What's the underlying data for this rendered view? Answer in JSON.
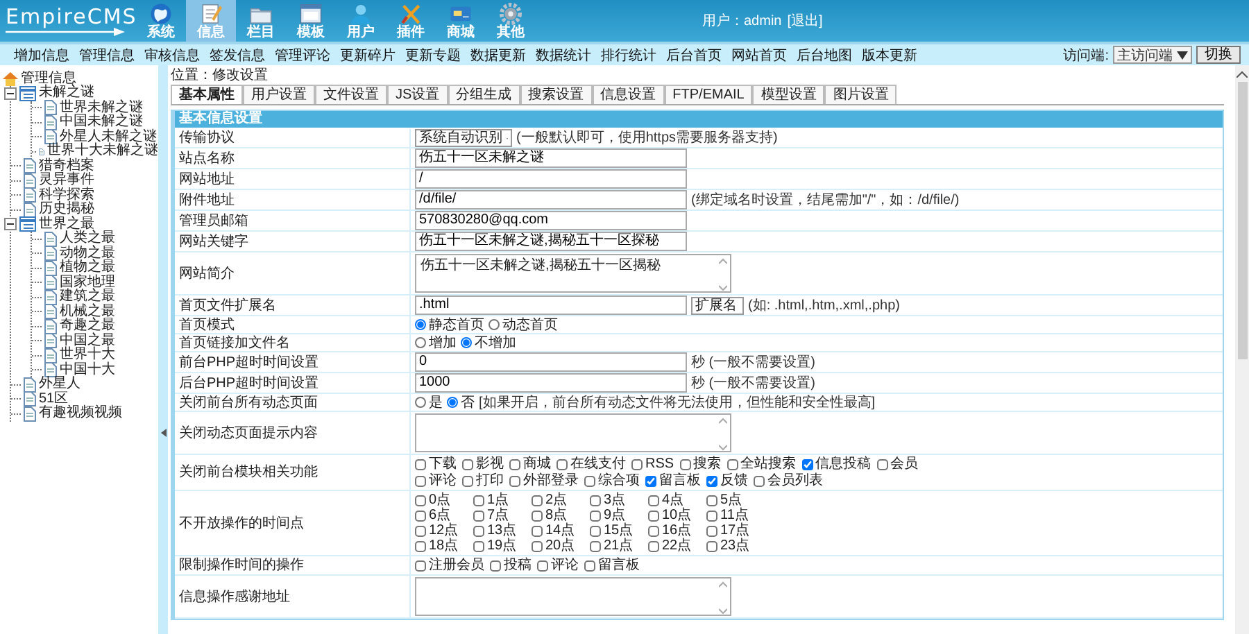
{
  "logo": "EmpireCMS",
  "nav": [
    {
      "label": "系统",
      "selected": false
    },
    {
      "label": "信息",
      "selected": true
    },
    {
      "label": "栏目",
      "selected": false
    },
    {
      "label": "模板",
      "selected": false
    },
    {
      "label": "用户",
      "selected": false
    },
    {
      "label": "插件",
      "selected": false
    },
    {
      "label": "商城",
      "selected": false
    },
    {
      "label": "其他",
      "selected": false
    }
  ],
  "user": {
    "text": "用户：admin",
    "logout": "[退出]"
  },
  "menu": [
    "增加信息",
    "管理信息",
    "审核信息",
    "签发信息",
    "管理评论",
    "更新碎片",
    "更新专题",
    "数据更新",
    "数据统计",
    "排行统计",
    "后台首页",
    "网站首页",
    "后台地图",
    "版本更新"
  ],
  "terminal": {
    "label": "访问端:",
    "value": "主访问端",
    "button": "切换"
  },
  "tree": {
    "label": "管理信息",
    "children": [
      {
        "label": "未解之谜",
        "expanded": true,
        "children": [
          {
            "label": "世界未解之谜"
          },
          {
            "label": "中国未解之谜"
          },
          {
            "label": "外星人未解之谜"
          },
          {
            "label": "世界十大未解之谜"
          }
        ]
      },
      {
        "label": "猎奇档案"
      },
      {
        "label": "灵异事件"
      },
      {
        "label": "科学探索"
      },
      {
        "label": "历史揭秘"
      },
      {
        "label": "世界之最",
        "expanded": true,
        "children": [
          {
            "label": "人类之最"
          },
          {
            "label": "动物之最"
          },
          {
            "label": "植物之最"
          },
          {
            "label": "国家地理"
          },
          {
            "label": "建筑之最"
          },
          {
            "label": "机械之最"
          },
          {
            "label": "奇趣之最"
          },
          {
            "label": "中国之最"
          },
          {
            "label": "世界十大"
          },
          {
            "label": "中国十大"
          }
        ]
      },
      {
        "label": "外星人"
      },
      {
        "label": "51区"
      },
      {
        "label": "有趣视频视频"
      }
    ]
  },
  "location": "位置：修改设置",
  "tabs": [
    {
      "label": "基本属性",
      "selected": true
    },
    {
      "label": "用户设置",
      "selected": false
    },
    {
      "label": "文件设置",
      "selected": false
    },
    {
      "label": "JS设置",
      "selected": false
    },
    {
      "label": "分组生成",
      "selected": false
    },
    {
      "label": "搜索设置",
      "selected": false
    },
    {
      "label": "信息设置",
      "selected": false
    },
    {
      "label": "FTP/EMAIL",
      "selected": false
    },
    {
      "label": "模型设置",
      "selected": false
    },
    {
      "label": "图片设置",
      "selected": false
    }
  ],
  "form": {
    "title": "基本信息设置",
    "rows": [
      {
        "label": "传输协议",
        "kind": "select",
        "value": "系统自动识别",
        "note": "(一般默认即可，使用https需要服务器支持)"
      },
      {
        "label": "站点名称",
        "kind": "text",
        "value": "伤五十一区未解之谜"
      },
      {
        "label": "网站地址",
        "kind": "text",
        "value": "/"
      },
      {
        "label": "附件地址",
        "kind": "text",
        "value": "/d/file/",
        "note": "(绑定域名时设置，结尾需加\"/\"，如：/d/file/)"
      },
      {
        "label": "管理员邮箱",
        "kind": "text",
        "value": "570830280@qq.com"
      },
      {
        "label": "网站关键字",
        "kind": "text",
        "value": "伤五十一区未解之谜,揭秘五十一区探秘"
      },
      {
        "label": "网站简介",
        "kind": "textarea",
        "value": "伤五十一区未解之谜,揭秘五十一区揭秘"
      },
      {
        "label": "首页文件扩展名",
        "kind": "text_select",
        "value": ".html",
        "select": "扩展名",
        "note": "(如: .html,.htm,.xml,.php)"
      },
      {
        "label": "首页模式",
        "kind": "radio",
        "options": [
          {
            "label": "静态首页",
            "selected": true
          },
          {
            "label": "动态首页",
            "selected": false
          }
        ]
      },
      {
        "label": "首页链接加文件名",
        "kind": "radio",
        "options": [
          {
            "label": "增加",
            "selected": false
          },
          {
            "label": "不增加",
            "selected": true
          }
        ]
      },
      {
        "label": "前台PHP超时时间设置",
        "kind": "text",
        "value": "0",
        "note": "秒 (一般不需要设置)"
      },
      {
        "label": "后台PHP超时时间设置",
        "kind": "text",
        "value": "1000",
        "note": "秒 (一般不需要设置)"
      },
      {
        "label": "关闭前台所有动态页面",
        "kind": "radio",
        "options": [
          {
            "label": "是",
            "selected": false
          },
          {
            "label": "否",
            "selected": true
          }
        ],
        "note": "[如果开启，前台所有动态文件将无法使用，但性能和安全性最高]"
      },
      {
        "label": "关闭动态页面提示内容",
        "kind": "textarea"
      },
      {
        "label": "关闭前台模块相关功能",
        "kind": "checks",
        "options": [
          {
            "label": "下载",
            "checked": false
          },
          {
            "label": "影视",
            "checked": false
          },
          {
            "label": "商城",
            "checked": false
          },
          {
            "label": "在线支付",
            "checked": false
          },
          {
            "label": "RSS",
            "checked": false
          },
          {
            "label": "搜索",
            "checked": false
          },
          {
            "label": "全站搜索",
            "checked": false
          },
          {
            "label": "信息投稿",
            "checked": true
          },
          {
            "label": "会员",
            "checked": false
          },
          {
            "label": "评论",
            "checked": false
          },
          {
            "label": "打印",
            "checked": false
          },
          {
            "label": "外部登录",
            "checked": false
          },
          {
            "label": "综合项",
            "checked": false
          },
          {
            "label": "留言板",
            "checked": true
          },
          {
            "label": "反馈",
            "checked": true
          },
          {
            "label": "会员列表",
            "checked": false
          }
        ]
      },
      {
        "label": "不开放操作的时间点",
        "kind": "hours",
        "options": [
          {
            "label": "0点",
            "checked": false
          },
          {
            "label": "1点",
            "checked": false
          },
          {
            "label": "2点",
            "checked": false
          },
          {
            "label": "3点",
            "checked": false
          },
          {
            "label": "4点",
            "checked": false
          },
          {
            "label": "5点",
            "checked": false
          },
          {
            "label": "6点",
            "checked": false
          },
          {
            "label": "7点",
            "checked": false
          },
          {
            "label": "8点",
            "checked": false
          },
          {
            "label": "9点",
            "checked": false
          },
          {
            "label": "10点",
            "checked": false
          },
          {
            "label": "11点",
            "checked": false
          },
          {
            "label": "12点",
            "checked": false
          },
          {
            "label": "13点",
            "checked": false
          },
          {
            "label": "14点",
            "checked": false
          },
          {
            "label": "15点",
            "checked": false
          },
          {
            "label": "16点",
            "checked": false
          },
          {
            "label": "17点",
            "checked": false
          },
          {
            "label": "18点",
            "checked": false
          },
          {
            "label": "19点",
            "checked": false
          },
          {
            "label": "20点",
            "checked": false
          },
          {
            "label": "21点",
            "checked": false
          },
          {
            "label": "22点",
            "checked": false
          },
          {
            "label": "23点",
            "checked": false
          }
        ]
      },
      {
        "label": "限制操作时间的操作",
        "kind": "checks",
        "options": [
          {
            "label": "注册会员",
            "checked": false
          },
          {
            "label": "投稿",
            "checked": false
          },
          {
            "label": "评论",
            "checked": false
          },
          {
            "label": "留言板",
            "checked": false
          }
        ]
      },
      {
        "label": "信息操作感谢地址",
        "kind": "textarea"
      }
    ]
  }
}
